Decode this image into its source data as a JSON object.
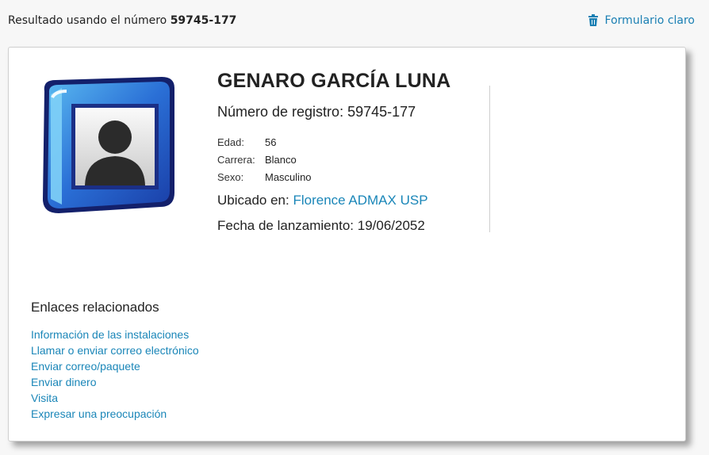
{
  "header": {
    "result_label": "Resultado usando el número",
    "result_number": "59745-177",
    "clear_form_label": "Formulario claro"
  },
  "person": {
    "name": "GENARO GARCÍA LUNA",
    "registration_label": "Número de registro:",
    "registration_number": "59745-177",
    "details": [
      {
        "label": "Edad:",
        "value": "56"
      },
      {
        "label": "Carrera:",
        "value": "Blanco"
      },
      {
        "label": "Sexo:",
        "value": "Masculino"
      }
    ],
    "located_label": "Ubicado en:",
    "located_value": "Florence ADMAX USP",
    "release_label": "Fecha de lanzamiento:",
    "release_date": "19/06/2052"
  },
  "related": {
    "title": "Enlaces relacionados",
    "links": [
      "Información de las instalaciones",
      "Llamar o enviar correo electrónico",
      "Enviar correo/paquete",
      "Enviar dinero",
      "Visita",
      "Expresar una preocupación"
    ]
  },
  "colors": {
    "link": "#1a86b8",
    "photo_frame": "#2a6fd6"
  },
  "icons": {
    "clear_form": "trash-icon",
    "photo": "person-placeholder-icon"
  }
}
